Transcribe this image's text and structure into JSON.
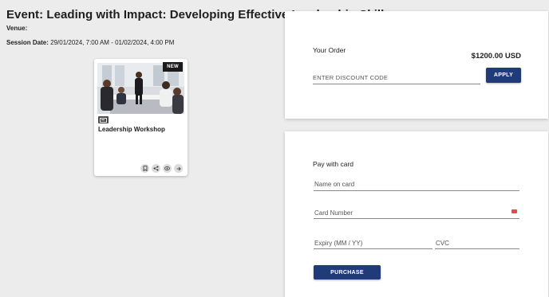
{
  "event": {
    "title": "Event: Leading with Impact: Developing Effective Leadership Skills",
    "venue_label": "Venue:",
    "session_label": "Session Date:",
    "session_value": " 29/01/2024, 7:00 AM - 01/02/2024, 4:00 PM"
  },
  "card": {
    "badge": "NEW",
    "type_icon": "slideshow-icon",
    "title": "Leadership Workshop",
    "actions": [
      "bookmark-icon",
      "share-icon",
      "eye-icon",
      "arrow-right-icon"
    ]
  },
  "order": {
    "label": "Your Order",
    "total": "$1200.00 USD",
    "discount_placeholder": "ENTER DISCOUNT CODE",
    "apply_label": "APPLY"
  },
  "payment": {
    "label": "Pay with card",
    "name_placeholder": "Name on card",
    "card_placeholder": "Card Number",
    "expiry_placeholder": "Expiry (MM / YY)",
    "cvc_placeholder": "CVC",
    "purchase_label": "PURCHASE"
  },
  "colors": {
    "primary": "#1f3b7a",
    "background": "#ececec"
  }
}
